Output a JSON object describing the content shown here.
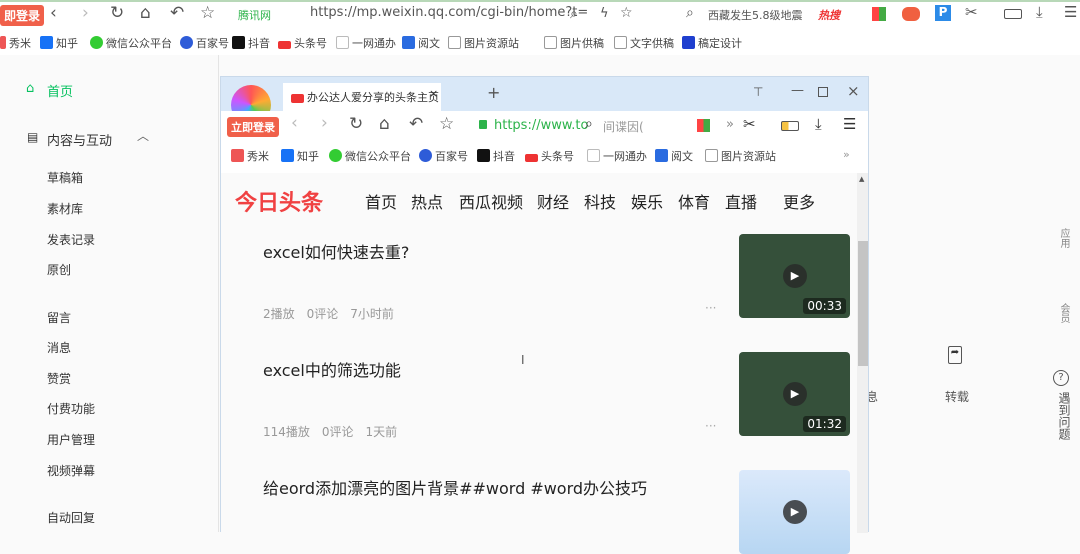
{
  "outer_browser": {
    "login": "即登录",
    "url": "https://mp.weixin.qq.com/cgi-bin/home?t=",
    "site_badge": "腾讯网",
    "search_hint": "西藏发生5.8级地震",
    "hot": "热搜",
    "bookmarks": [
      "秀米",
      "知乎",
      "微信公众平台",
      "百家号",
      "抖音",
      "头条号",
      "一网通办",
      "阅文",
      "图片资源站",
      "图片供稿",
      "文字供稿",
      "稿定设计"
    ]
  },
  "sidebar": {
    "home": "首页",
    "section": "内容与互动",
    "items": [
      "草稿箱",
      "素材库",
      "发表记录",
      "原创",
      "留言",
      "消息",
      "赞赏",
      "付费功能",
      "用户管理",
      "视频弹幕",
      "自动回复"
    ]
  },
  "inner_browser": {
    "login": "立即登录",
    "tab_title": "办公达人爱分享的头条主页 - 今",
    "url": "https://www.to",
    "search_hint": "间谍因(",
    "bookmarks": [
      "秀米",
      "知乎",
      "微信公众平台",
      "百家号",
      "抖音",
      "头条号",
      "一网通办",
      "阅文",
      "图片资源站"
    ]
  },
  "toutiao": {
    "logo": "今日头条",
    "nav": [
      "首页",
      "热点",
      "西瓜视频",
      "财经",
      "科技",
      "娱乐",
      "体育",
      "直播",
      "更多"
    ],
    "articles": [
      {
        "title": "excel如何快速去重?",
        "plays": "2播放",
        "comments": "0评论",
        "time": "7小时前",
        "duration": "00:33"
      },
      {
        "title": "excel中的筛选功能",
        "plays": "114播放",
        "comments": "0评论",
        "time": "1天前",
        "duration": "01:32"
      },
      {
        "title": "给eord添加漂亮的图片背景##word #word办公技巧",
        "plays": "",
        "comments": "",
        "time": "",
        "duration": ""
      }
    ]
  },
  "background": {
    "partial": "息",
    "repost": "转载",
    "apps": "应用",
    "member": "会员",
    "help": "遇到问题"
  },
  "colors": {
    "green": "#07c160",
    "toutiao_red": "#f04142"
  }
}
